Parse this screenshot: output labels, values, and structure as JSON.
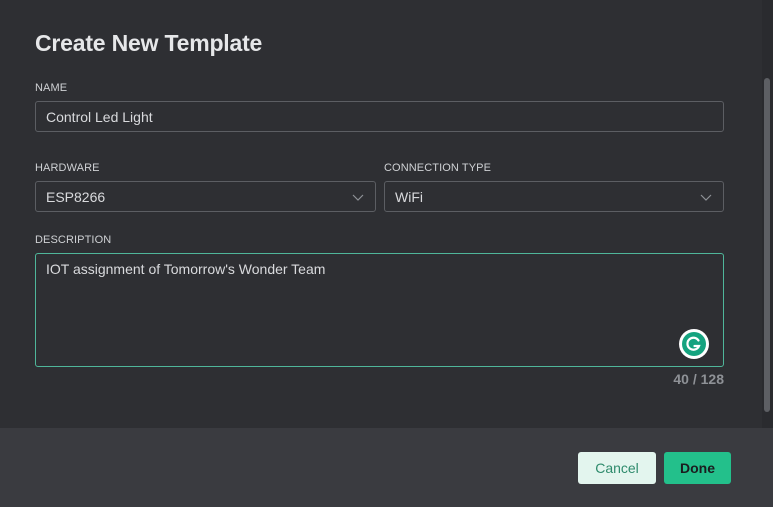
{
  "dialog": {
    "title": "Create New Template"
  },
  "form": {
    "name": {
      "label": "NAME",
      "value": "Control Led Light"
    },
    "hardware": {
      "label": "HARDWARE",
      "value": "ESP8266"
    },
    "connection_type": {
      "label": "CONNECTION TYPE",
      "value": "WiFi"
    },
    "description": {
      "label": "DESCRIPTION",
      "value": "IOT assignment of Tomorrow's Wonder Team",
      "counter": "40 / 128"
    }
  },
  "footer": {
    "cancel_label": "Cancel",
    "done_label": "Done"
  },
  "icons": {
    "dropdown": "chevron-down-icon",
    "grammarly": "grammarly-icon"
  },
  "colors": {
    "accent": "#23c08b",
    "focus_border": "#4fb69a",
    "background": "#2e2f33",
    "footer_background": "#3a3b40"
  }
}
